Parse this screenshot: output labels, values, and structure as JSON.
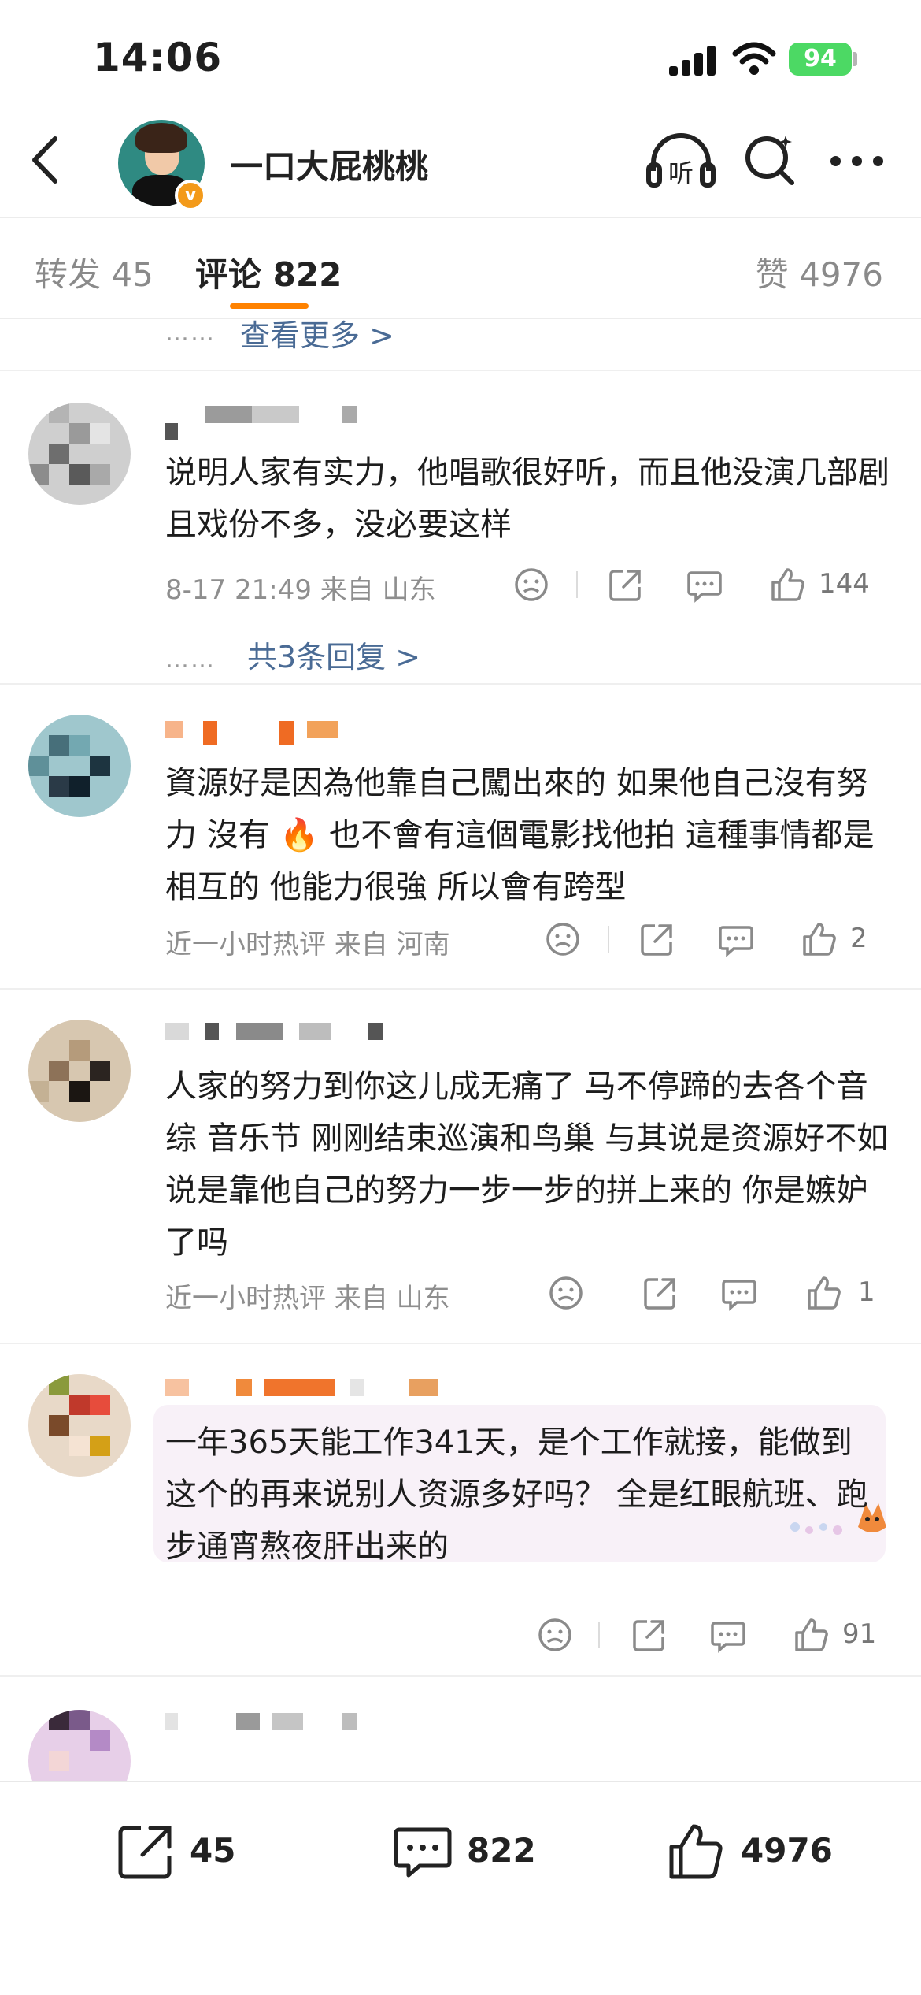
{
  "status_bar": {
    "time": "14:06",
    "battery": "94"
  },
  "header": {
    "username": "一口大屁桃桃",
    "listen_label": "听",
    "verified_badge": "v"
  },
  "tabs": {
    "repost": "转发 45",
    "comment": "评论 822",
    "like": "赞 4976"
  },
  "feed": {
    "more_link": "查看更多 >",
    "comments": [
      {
        "text": "说明人家有实力，他唱歌很好听，而且他没演几部剧且戏份不多，没必要这样",
        "meta": "8-17 21:49  来自 山东",
        "likes": "144",
        "replies": "共3条回复 >"
      },
      {
        "text": "資源好是因為他靠自己闖出來的 如果他自己沒有努力 沒有 🔥 也不會有這個電影找他拍 這種事情都是相互的 他能力很強 所以會有跨型",
        "meta": "近一小时热评  来自 河南",
        "likes": "2"
      },
      {
        "text": "人家的努力到你这儿成无痛了 马不停蹄的去各个音综 音乐节 刚刚结束巡演和鸟巢 与其说是资源好不如说是靠他自己的努力一步一步的拼上来的 你是嫉妒了吗",
        "meta": "近一小时热评  来自 山东",
        "likes": "1"
      },
      {
        "text": "一年365天能工作341天，是个工作就接，能做到这个的再来说别人资源多好吗？ 全是红眼航班、跑步通宵熬夜肝出来的",
        "likes": "91"
      }
    ]
  },
  "bottom_bar": {
    "repost_count": "45",
    "comment_count": "822",
    "like_count": "4976"
  },
  "colors": {
    "accent": "#ff8200",
    "link": "#4a6b95",
    "battery": "#4cd964",
    "verified": "#f39a1a"
  }
}
